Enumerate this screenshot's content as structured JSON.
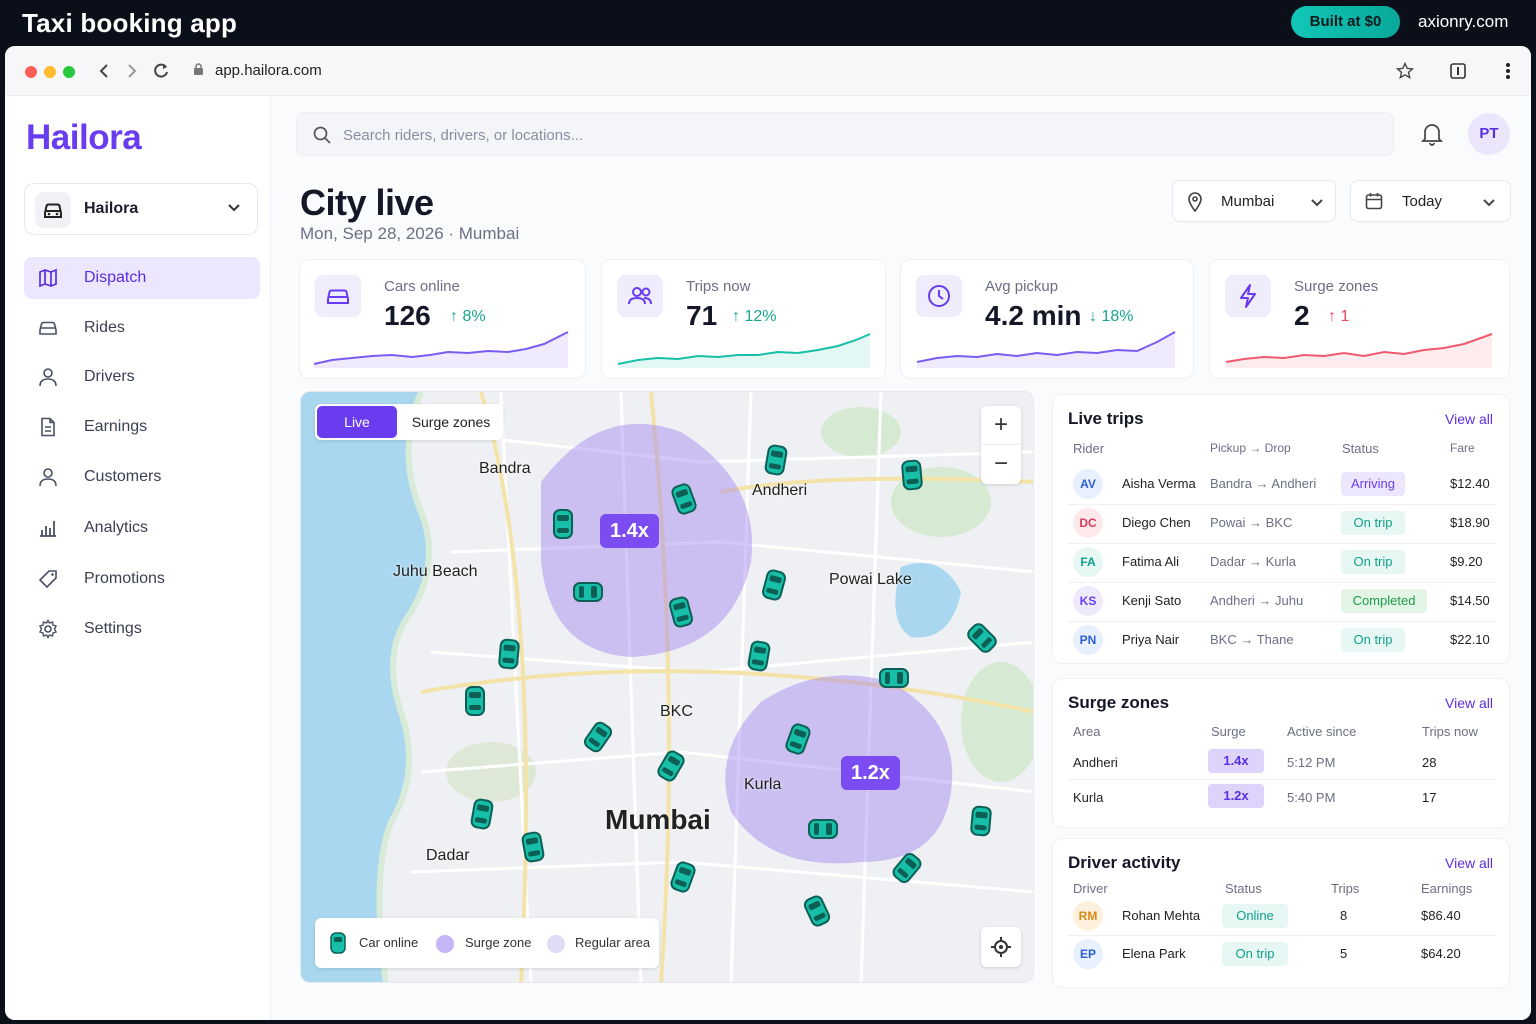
{
  "banner": {
    "title": "Taxi booking app",
    "built_label": "Built at $0",
    "domain": "axionry.com"
  },
  "browser": {
    "url": "app.hailora.com"
  },
  "sidebar": {
    "logo": "Hailora",
    "org": "Hailora",
    "items": [
      {
        "label": "Dispatch",
        "icon": "map-icon",
        "active": true
      },
      {
        "label": "Rides",
        "icon": "car-icon"
      },
      {
        "label": "Drivers",
        "icon": "user-icon"
      },
      {
        "label": "Earnings",
        "icon": "document-icon"
      },
      {
        "label": "Customers",
        "icon": "user-icon"
      },
      {
        "label": "Analytics",
        "icon": "bar-chart-icon"
      },
      {
        "label": "Promotions",
        "icon": "tag-icon"
      },
      {
        "label": "Settings",
        "icon": "gear-icon"
      }
    ]
  },
  "header": {
    "search_placeholder": "Search riders, drivers, or locations...",
    "avatar": "PT",
    "title": "City live",
    "subtitle": "Mon, Sep 28, 2026 · Mumbai",
    "city": "Mumbai",
    "period": "Today"
  },
  "kpis": [
    {
      "label": "Cars online",
      "value": "126",
      "delta": "8%",
      "dir": "up",
      "color": "#7c5cf0"
    },
    {
      "label": "Trips now",
      "value": "71",
      "delta": "12%",
      "dir": "up",
      "color": "#17bfa8"
    },
    {
      "label": "Avg pickup",
      "value": "4.2 min",
      "delta": "18%",
      "dir": "down",
      "color": "#7c5cf0"
    },
    {
      "label": "Surge zones",
      "value": "2",
      "delta": "1",
      "dir": "up",
      "color": "#ef5a6f"
    }
  ],
  "map": {
    "tab_live": "Live",
    "tab_surge": "Surge zones",
    "zoom_in": "+",
    "zoom_out": "−",
    "labels": [
      "Bandra",
      "Andheri",
      "Juhu Beach",
      "Powai Lake",
      "BKC",
      "Kurla",
      "Mumbai",
      "Dadar"
    ],
    "surge_a": "1.4x",
    "surge_b": "1.2x",
    "legend": {
      "car": "Car online",
      "surge": "Surge zone",
      "regular": "Regular area"
    }
  },
  "live_trips": {
    "title": "Live trips",
    "view_all": "View all",
    "headers": [
      "Rider",
      "Pickup → Drop",
      "Status",
      "Fare"
    ],
    "rows": [
      {
        "initials": "AV",
        "name": "Aisha Verma",
        "route": "Bandra → Andheri",
        "status": "Arriving",
        "fare": "$12.40"
      },
      {
        "initials": "DC",
        "name": "Diego Chen",
        "route": "Powai → BKC",
        "status": "On trip",
        "fare": "$18.90"
      },
      {
        "initials": "FA",
        "name": "Fatima Ali",
        "route": "Dadar → Kurla",
        "status": "On trip",
        "fare": "$9.20"
      },
      {
        "initials": "KS",
        "name": "Kenji Sato",
        "route": "Andheri → Juhu",
        "status": "Completed",
        "fare": "$14.50"
      },
      {
        "initials": "PN",
        "name": "Priya Nair",
        "route": "BKC → Thane",
        "status": "On trip",
        "fare": "$22.10"
      }
    ]
  },
  "surge_zones": {
    "title": "Surge zones",
    "view_all": "View all",
    "headers": [
      "Area",
      "Surge",
      "Active since",
      "Trips now"
    ],
    "rows": [
      {
        "area": "Andheri",
        "surge": "1.4x",
        "since": "5:12 PM",
        "trips": "28"
      },
      {
        "area": "Kurla",
        "surge": "1.2x",
        "since": "5:40 PM",
        "trips": "17"
      }
    ]
  },
  "driver_activity": {
    "title": "Driver activity",
    "view_all": "View all",
    "headers": [
      "Driver",
      "Status",
      "Trips",
      "Earnings"
    ],
    "rows": [
      {
        "initials": "RM",
        "name": "Rohan Mehta",
        "status": "Online",
        "trips": "8",
        "earnings": "$86.40"
      },
      {
        "initials": "EP",
        "name": "Elena Park",
        "status": "On trip",
        "trips": "5",
        "earnings": "$64.20"
      }
    ]
  }
}
